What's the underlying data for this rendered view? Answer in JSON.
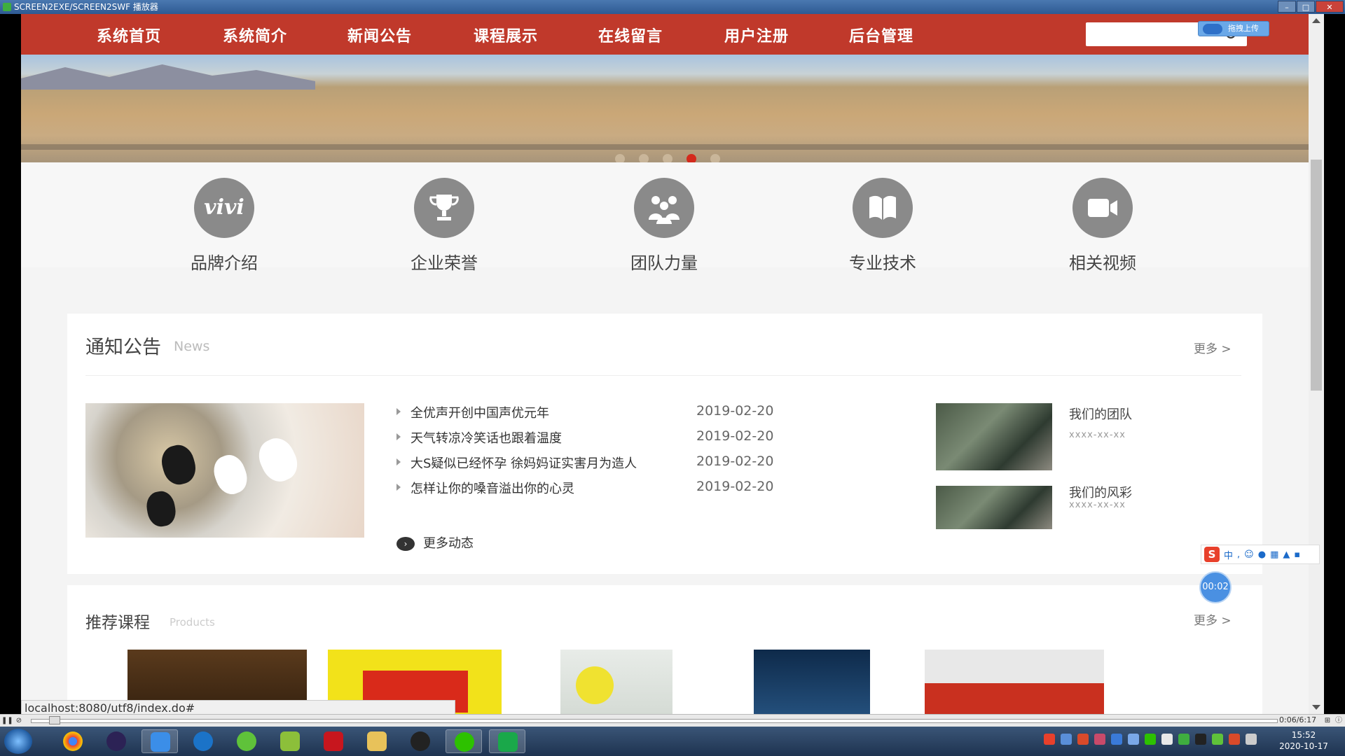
{
  "window": {
    "title": "SCREEN2EXE/SCREEN2SWF 播放器"
  },
  "nav": {
    "items": [
      "系统首页",
      "系统简介",
      "新闻公告",
      "课程展示",
      "在线留言",
      "用户注册",
      "后台管理"
    ],
    "upload_label": "拖拽上传"
  },
  "banner": {
    "active_slide": 4,
    "slide_count": 5
  },
  "features": [
    {
      "label": "品牌介绍",
      "icon": "vivi-logo-icon",
      "glyph": "vivi"
    },
    {
      "label": "企业荣誉",
      "icon": "trophy-icon"
    },
    {
      "label": "团队力量",
      "icon": "team-icon"
    },
    {
      "label": "专业技术",
      "icon": "book-icon"
    },
    {
      "label": "相关视频",
      "icon": "video-camera-icon"
    }
  ],
  "news": {
    "title": "通知公告",
    "subtitle": "News",
    "more": "更多 >",
    "items": [
      {
        "title": "全优声开创中国声优元年",
        "date": "2019-02-20"
      },
      {
        "title": "天气转凉冷笑话也跟着温度",
        "date": "2019-02-20"
      },
      {
        "title": "大S疑似已经怀孕 徐妈妈证实害月为造人",
        "date": "2019-02-20"
      },
      {
        "title": "怎样让你的嗓音溢出你的心灵",
        "date": "2019-02-20"
      }
    ],
    "more_news": "更多动态",
    "side": [
      {
        "title": "我们的团队",
        "date": "xxxx-xx-xx"
      },
      {
        "title": "我们的风彩",
        "date": "xxxx-xx-xx"
      }
    ]
  },
  "courses": {
    "title": "推荐课程",
    "subtitle": "Products",
    "more": "更多 >"
  },
  "status": {
    "url": "localhost:8080/utf8/index.do#"
  },
  "ime": {
    "mode": "中"
  },
  "timer": {
    "value": "00:02"
  },
  "player": {
    "time": "0:06/6:17"
  },
  "clock": {
    "time": "15:52",
    "date": "2020-10-17"
  },
  "colors": {
    "nav": "#c0392b",
    "active_dot": "#d42a1c"
  }
}
